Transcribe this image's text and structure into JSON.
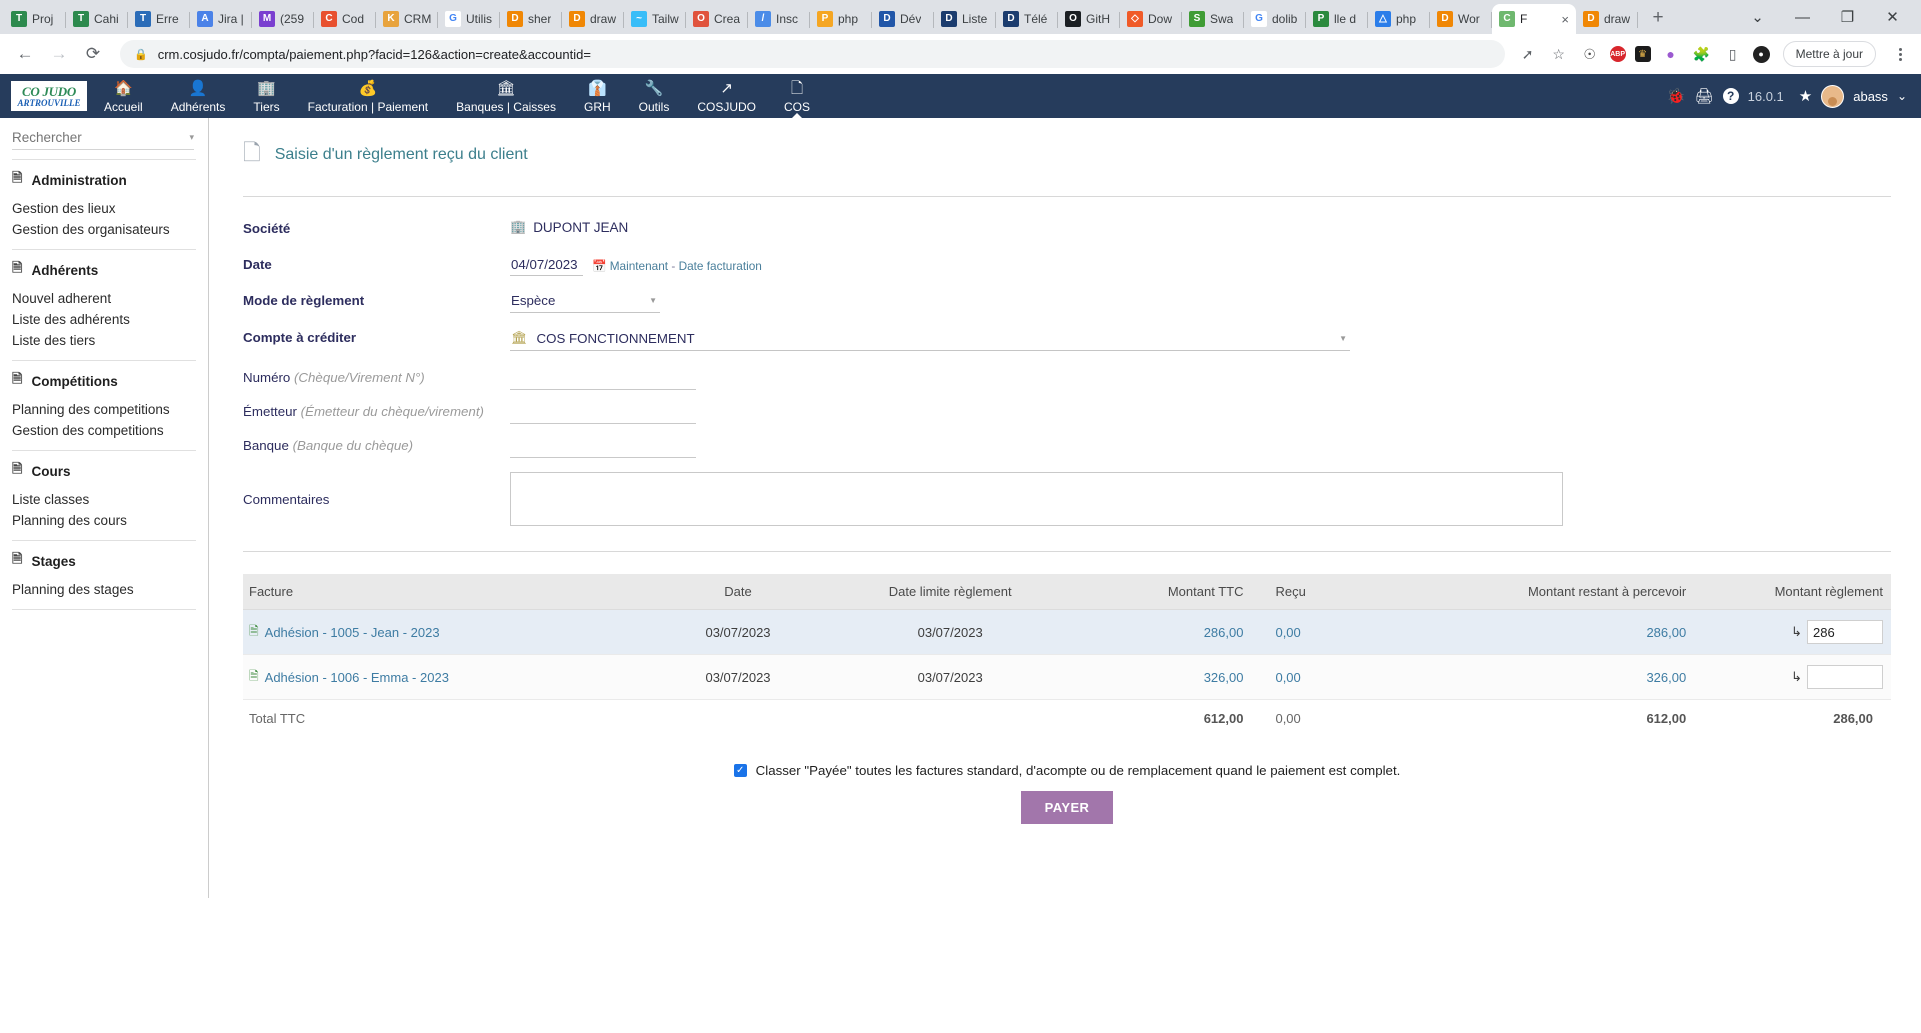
{
  "browser": {
    "tabs": [
      {
        "title": "Proj",
        "favicon": "T",
        "color": "#2d8a4e",
        "active": false
      },
      {
        "title": "Cahi",
        "favicon": "T",
        "color": "#2d8a4e",
        "active": false
      },
      {
        "title": "Erre",
        "favicon": "T",
        "color": "#2b6cb8",
        "active": false
      },
      {
        "title": "Jira |",
        "favicon": "A",
        "color": "#4b82e8",
        "active": false
      },
      {
        "title": "(259",
        "favicon": "M",
        "color": "#7a3fd0",
        "active": false
      },
      {
        "title": "Cod",
        "favicon": "C",
        "color": "#e8502f",
        "active": false
      },
      {
        "title": "CRM",
        "favicon": "K",
        "color": "#e8a33d",
        "active": false
      },
      {
        "title": "Utilis",
        "favicon": "G",
        "color": "#ffffff",
        "active": false
      },
      {
        "title": "sher",
        "favicon": "D",
        "color": "#f08705",
        "active": false
      },
      {
        "title": "draw",
        "favicon": "D",
        "color": "#f08705",
        "active": false
      },
      {
        "title": "Tailw",
        "favicon": "~",
        "color": "#38bdf8",
        "active": false
      },
      {
        "title": "Crea",
        "favicon": "O",
        "color": "#e0533d",
        "active": false
      },
      {
        "title": "Insc",
        "favicon": "/",
        "color": "#4b8ce8",
        "active": false
      },
      {
        "title": "php",
        "favicon": "P",
        "color": "#f5a623",
        "active": false
      },
      {
        "title": "Dév",
        "favicon": "D",
        "color": "#2156a8",
        "active": false
      },
      {
        "title": "Liste",
        "favicon": "D",
        "color": "#1b3c6e",
        "active": false
      },
      {
        "title": "Télé",
        "favicon": "D",
        "color": "#1b3c6e",
        "active": false
      },
      {
        "title": "GitH",
        "favicon": "O",
        "color": "#1b1f23",
        "active": false
      },
      {
        "title": "Dow",
        "favicon": "◇",
        "color": "#f05a28",
        "active": false
      },
      {
        "title": "Swa",
        "favicon": "S",
        "color": "#3f9c35",
        "active": false
      },
      {
        "title": "dolib",
        "favicon": "G",
        "color": "#ffffff",
        "active": false
      },
      {
        "title": "lle d",
        "favicon": "P",
        "color": "#2b8a3e",
        "active": false
      },
      {
        "title": "php",
        "favicon": "△",
        "color": "#2b7de9",
        "active": false
      },
      {
        "title": "Wor",
        "favicon": "D",
        "color": "#f08705",
        "active": false
      },
      {
        "title": "F",
        "favicon": "C",
        "color": "#6fb86f",
        "active": true
      },
      {
        "title": "draw",
        "favicon": "D",
        "color": "#f08705",
        "active": false
      }
    ],
    "new_tab_label": "+",
    "tab_close_label": "×",
    "tab_list_chevron": "⌄",
    "window_minimize": "—",
    "window_maximize": "❐",
    "window_close": "✕",
    "back_icon": "←",
    "forward_icon": "→",
    "reload_icon": "⟳",
    "lock_icon": "🔒",
    "url": "crm.cosjudo.fr/compta/paiement.php?facid=126&action=create&accountid=",
    "toolbar_icons": [
      "share-icon",
      "bookmark-star-icon",
      "pocket-icon",
      "adblock-icon",
      "extension-gold-icon",
      "extension-purple-icon",
      "extensions-puzzle-icon",
      "sidebar-icon",
      "profile-dark-icon"
    ],
    "update_button": "Mettre à jour",
    "menu_icon": "kebab-menu"
  },
  "appnav": {
    "brand_line1": "CO",
    "brand_line1_accent": "JUDO",
    "brand_line2": "ARTROUVILLE",
    "items": [
      {
        "label": "Accueil",
        "icon": "🏠",
        "active": false
      },
      {
        "label": "Adhérents",
        "icon": "👤",
        "active": false
      },
      {
        "label": "Tiers",
        "icon": "🏢",
        "active": false
      },
      {
        "label": "Facturation | Paiement",
        "icon": "💰",
        "active": false
      },
      {
        "label": "Banques | Caisses",
        "icon": "🏛",
        "active": false
      },
      {
        "label": "GRH",
        "icon": "👔",
        "active": false
      },
      {
        "label": "Outils",
        "icon": "🔧",
        "active": false
      },
      {
        "label": "COSJUDO",
        "icon": "↗",
        "active": false
      },
      {
        "label": "COS",
        "icon": "🗋",
        "active": true
      }
    ],
    "right": {
      "bug_icon": "🐞",
      "print_icon": "🖨",
      "help_icon": "?",
      "version": "16.0.1",
      "star_icon": "★",
      "username": "abass",
      "user_caret": "⌄"
    }
  },
  "sidebar": {
    "search_placeholder": "Rechercher",
    "search_value": "",
    "caret": "▾",
    "groups": [
      {
        "title": "Administration",
        "icon": "🗎",
        "links": [
          "Gestion des lieux",
          "Gestion des organisateurs"
        ]
      },
      {
        "title": "Adhérents",
        "icon": "🗎",
        "links": [
          "Nouvel adherent",
          "Liste des adhérents",
          "Liste des tiers"
        ]
      },
      {
        "title": "Compétitions",
        "icon": "🗎",
        "links": [
          "Planning des competitions",
          "Gestion des competitions"
        ]
      },
      {
        "title": "Cours",
        "icon": "🗎",
        "links": [
          "Liste classes",
          "Planning des cours"
        ]
      },
      {
        "title": "Stages",
        "icon": "🗎",
        "links": [
          "Planning des stages"
        ]
      }
    ]
  },
  "main": {
    "title": "Saisie d'un règlement reçu du client",
    "title_icon": "🗋",
    "form": {
      "societe_label": "Société",
      "societe_value": "DUPONT JEAN",
      "societe_icon": "🏢",
      "date_label": "Date",
      "date_value": "04/07/2023",
      "date_calendar_icon": "📅",
      "date_now_link": "Maintenant",
      "date_sep": "-",
      "date_facturation_link": "Date facturation",
      "mode_label": "Mode de règlement",
      "mode_value": "Espèce",
      "compte_label": "Compte à créditer",
      "compte_value": "COS FONCTIONNEMENT",
      "compte_icon": "🏛",
      "numero_label": "Numéro",
      "numero_hint": "(Chèque/Virement N°)",
      "numero_value": "",
      "emetteur_label": "Émetteur",
      "emetteur_hint": "(Émetteur du chèque/virement)",
      "emetteur_value": "",
      "banque_label": "Banque",
      "banque_hint": "(Banque du chèque)",
      "banque_value": "",
      "commentaires_label": "Commentaires",
      "commentaires_value": ""
    },
    "table": {
      "headers": [
        "Facture",
        "Date",
        "Date limite règlement",
        "Montant TTC",
        "Reçu",
        "Montant restant à percevoir",
        "Montant règlement"
      ],
      "rows": [
        {
          "facture": "Adhésion - 1005 - Jean - 2023",
          "date": "03/07/2023",
          "date_limite": "03/07/2023",
          "montant_ttc": "286,00",
          "recu": "0,00",
          "restant": "286,00",
          "reglement_value": "286",
          "arrow": "↳"
        },
        {
          "facture": "Adhésion - 1006 - Emma - 2023",
          "date": "03/07/2023",
          "date_limite": "03/07/2023",
          "montant_ttc": "326,00",
          "recu": "0,00",
          "restant": "326,00",
          "reglement_value": "",
          "arrow": "↳"
        }
      ],
      "total": {
        "label": "Total TTC",
        "montant_ttc": "612,00",
        "recu": "0,00",
        "restant": "612,00",
        "reglement": "286,00"
      }
    },
    "footer": {
      "checkbox_checked": true,
      "checkbox_mark": "✓",
      "checkbox_label": "Classer \"Payée\" toutes les factures standard, d'acompte ou de remplacement quand le paiement est complet.",
      "pay_button": "PAYER"
    }
  }
}
